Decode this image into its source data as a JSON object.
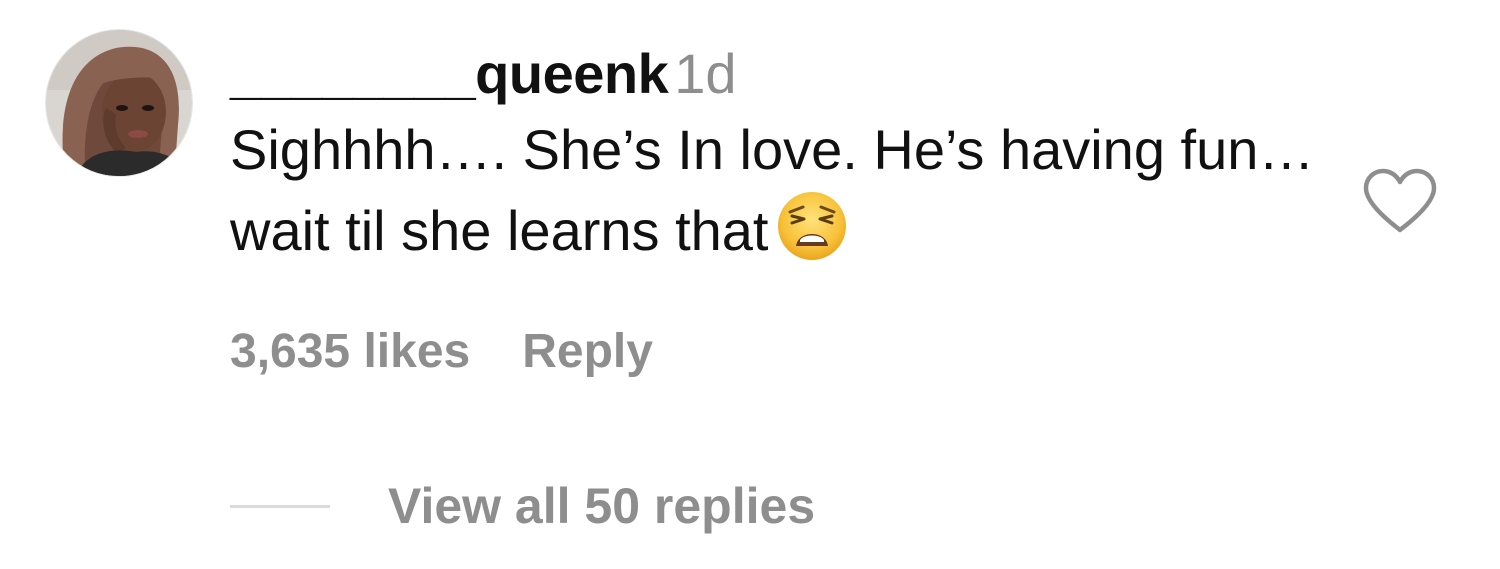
{
  "comment": {
    "username": "________queenk",
    "timestamp": "1d",
    "text": "Sighhhh…. She’s In love. He’s having fun… wait til she learns that",
    "emoji": "weary-face-emoji",
    "likes_label": "3,635 likes",
    "reply_label": "Reply",
    "view_replies_label": "View all 50 replies",
    "like_icon": "heart-outline-icon",
    "avatar": "profile-photo"
  },
  "colors": {
    "primary_text": "#111111",
    "secondary_text": "#8e8e8e",
    "divider": "#dbdbdb",
    "background": "#ffffff"
  }
}
